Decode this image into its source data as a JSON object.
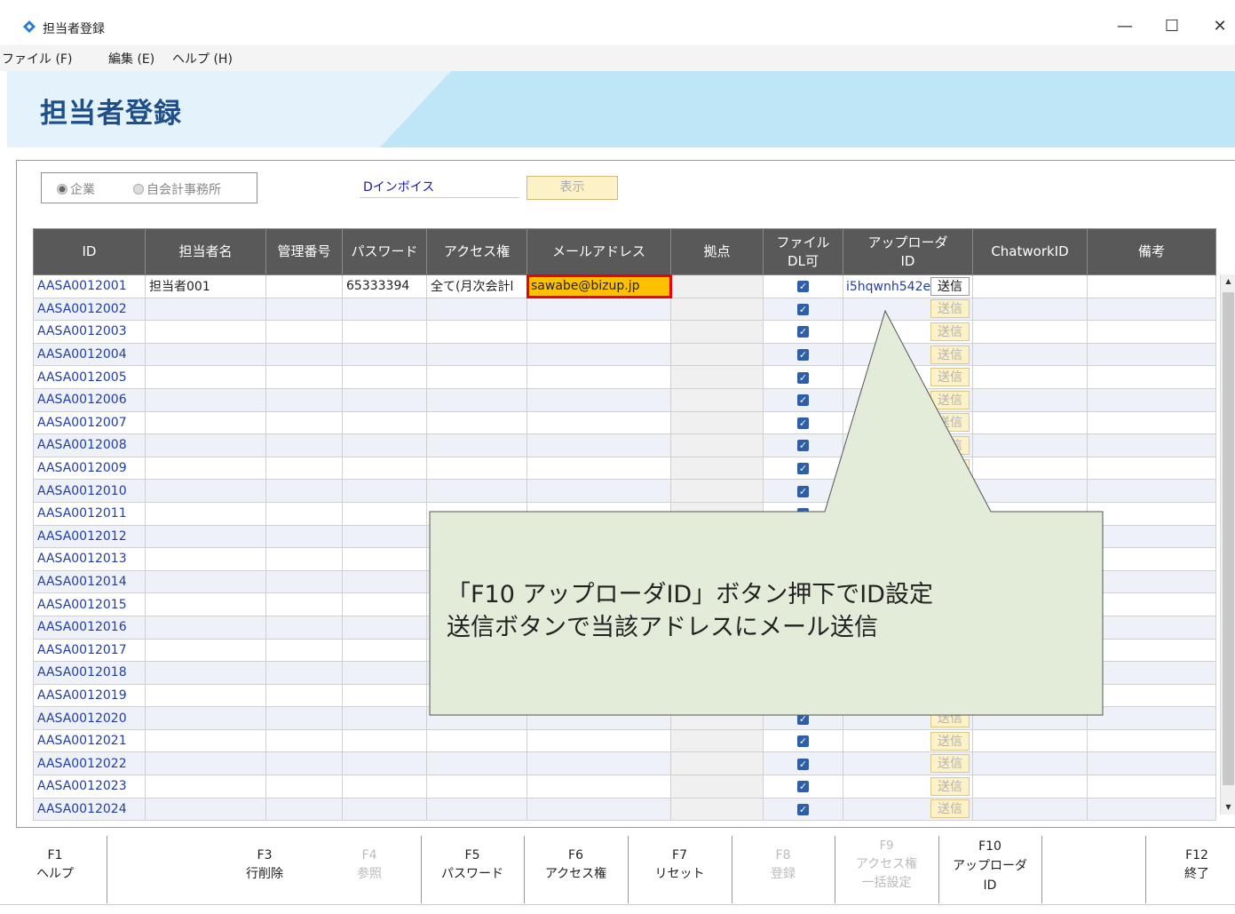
{
  "window": {
    "title": "担当者登録",
    "minimize": "—",
    "maximize": "☐",
    "close": "✕"
  },
  "menu": {
    "file": "ファイル (F)",
    "edit": "編集 (E)",
    "help": "ヘルプ (H)"
  },
  "page_title": "担当者登録",
  "filter": {
    "radio_company": "企業",
    "radio_accounting": "自会計事務所",
    "company_name": "Dインボイス",
    "show_button": "表示"
  },
  "table": {
    "headers": {
      "id": "ID",
      "name": "担当者名",
      "mgmt_no": "管理番号",
      "password": "パスワード",
      "access": "アクセス権",
      "email": "メールアドレス",
      "base": "拠点",
      "file_dl_1": "ファイル",
      "file_dl_2": "DL可",
      "uploader_1": "アップローダ",
      "uploader_2": "ID",
      "chatwork": "ChatworkID",
      "notes": "備考"
    },
    "send_label": "送信",
    "check_mark": "✓",
    "rows": [
      {
        "id": "AASA0012001",
        "name": "担当者001",
        "password": "65333394",
        "access": "全て(月次会計l",
        "email": "sawabe@bizup.jp",
        "uploader_id": "i5hqwnh542e"
      },
      {
        "id": "AASA0012002"
      },
      {
        "id": "AASA0012003"
      },
      {
        "id": "AASA0012004"
      },
      {
        "id": "AASA0012005"
      },
      {
        "id": "AASA0012006"
      },
      {
        "id": "AASA0012007"
      },
      {
        "id": "AASA0012008"
      },
      {
        "id": "AASA0012009"
      },
      {
        "id": "AASA0012010"
      },
      {
        "id": "AASA0012011"
      },
      {
        "id": "AASA0012012"
      },
      {
        "id": "AASA0012013"
      },
      {
        "id": "AASA0012014"
      },
      {
        "id": "AASA0012015"
      },
      {
        "id": "AASA0012016"
      },
      {
        "id": "AASA0012017"
      },
      {
        "id": "AASA0012018"
      },
      {
        "id": "AASA0012019"
      },
      {
        "id": "AASA0012020"
      },
      {
        "id": "AASA0012021"
      },
      {
        "id": "AASA0012022"
      },
      {
        "id": "AASA0012023"
      },
      {
        "id": "AASA0012024"
      }
    ]
  },
  "callout": {
    "line1": "「F10 アップローダID」ボタン押下でID設定",
    "line2": "送信ボタンで当該アドレスにメール送信"
  },
  "fkeys": {
    "f1": {
      "key": "F1",
      "label": "ヘルプ"
    },
    "f3": {
      "key": "F3",
      "label": "行削除"
    },
    "f4": {
      "key": "F4",
      "label": "参照"
    },
    "f5": {
      "key": "F5",
      "label": "パスワード"
    },
    "f6": {
      "key": "F6",
      "label": "アクセス権"
    },
    "f7": {
      "key": "F7",
      "label": "リセット"
    },
    "f8": {
      "key": "F8",
      "label": "登録"
    },
    "f9": {
      "key": "F9",
      "label1": "アクセス権",
      "label2": "一括設定"
    },
    "f10": {
      "key": "F10",
      "label1": "アップローダ",
      "label2": "ID"
    },
    "f12": {
      "key": "F12",
      "label": "終了"
    }
  }
}
